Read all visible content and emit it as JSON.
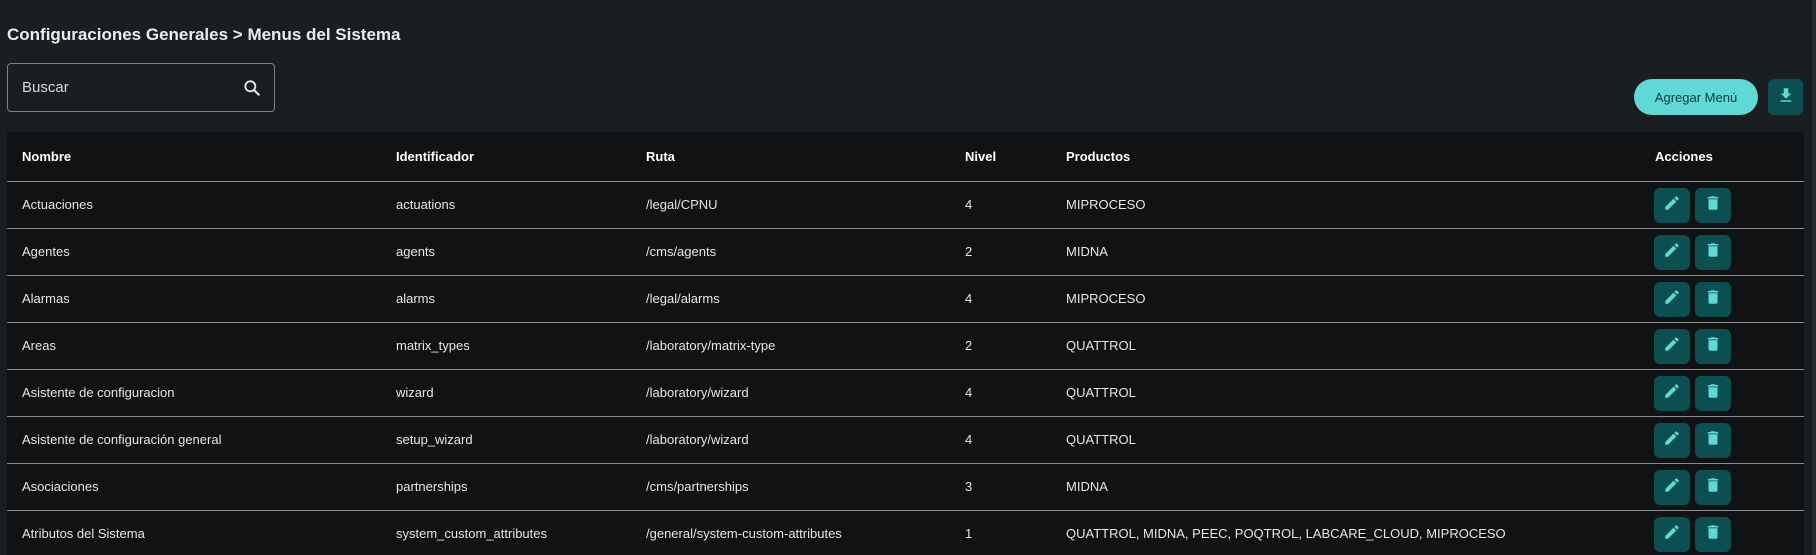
{
  "breadcrumb": "Configuraciones Generales > Menus del Sistema",
  "search": {
    "placeholder": "Buscar",
    "value": ""
  },
  "toolbar": {
    "add_label": "Agregar Menú"
  },
  "table": {
    "headers": {
      "nombre": "Nombre",
      "identificador": "Identificador",
      "ruta": "Ruta",
      "nivel": "Nivel",
      "productos": "Productos",
      "acciones": "Acciones"
    },
    "rows": [
      {
        "nombre": "Actuaciones",
        "identificador": "actuations",
        "ruta": "/legal/CPNU",
        "nivel": "4",
        "productos": "MIPROCESO"
      },
      {
        "nombre": "Agentes",
        "identificador": "agents",
        "ruta": "/cms/agents",
        "nivel": "2",
        "productos": "MIDNA"
      },
      {
        "nombre": "Alarmas",
        "identificador": "alarms",
        "ruta": "/legal/alarms",
        "nivel": "4",
        "productos": "MIPROCESO"
      },
      {
        "nombre": "Areas",
        "identificador": "matrix_types",
        "ruta": "/laboratory/matrix-type",
        "nivel": "2",
        "productos": "QUATTROL"
      },
      {
        "nombre": "Asistente de configuracion",
        "identificador": "wizard",
        "ruta": "/laboratory/wizard",
        "nivel": "4",
        "productos": "QUATTROL"
      },
      {
        "nombre": "Asistente de configuración general",
        "identificador": "setup_wizard",
        "ruta": "/laboratory/wizard",
        "nivel": "4",
        "productos": "QUATTROL"
      },
      {
        "nombre": "Asociaciones",
        "identificador": "partnerships",
        "ruta": "/cms/partnerships",
        "nivel": "3",
        "productos": "MIDNA"
      },
      {
        "nombre": "Atributos del Sistema",
        "identificador": "system_custom_attributes",
        "ruta": "/general/system-custom-attributes",
        "nivel": "1",
        "productos": "QUATTROL, MIDNA, PEEC, POQTROL, LABCARE_CLOUD, MIPROCESO"
      }
    ]
  },
  "icons": {
    "search": "search-icon",
    "download": "download-icon",
    "edit": "pencil-icon",
    "delete": "trash-icon"
  },
  "colors": {
    "accent": "#5fd8d6",
    "action_bg": "#0b4f50",
    "background": "#1b1e20",
    "table_bg": "#111213"
  }
}
